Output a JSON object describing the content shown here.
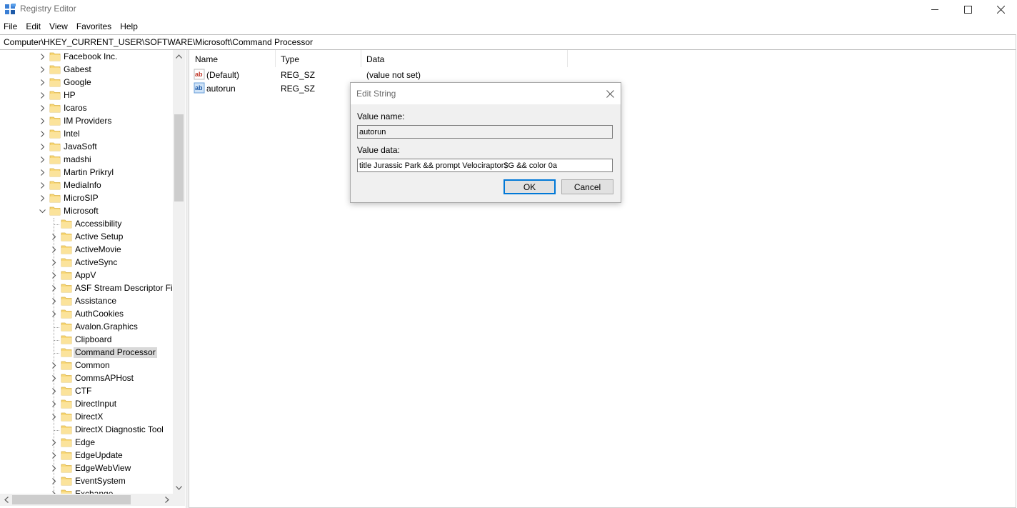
{
  "window": {
    "title": "Registry Editor"
  },
  "menu": [
    "File",
    "Edit",
    "View",
    "Favorites",
    "Help"
  ],
  "address": "Computer\\HKEY_CURRENT_USER\\SOFTWARE\\Microsoft\\Command Processor",
  "tree": {
    "items": [
      {
        "label": "Facebook Inc.",
        "level": 1,
        "expander": "collapsed"
      },
      {
        "label": "Gabest",
        "level": 1,
        "expander": "collapsed"
      },
      {
        "label": "Google",
        "level": 1,
        "expander": "collapsed"
      },
      {
        "label": "HP",
        "level": 1,
        "expander": "collapsed"
      },
      {
        "label": "Icaros",
        "level": 1,
        "expander": "collapsed"
      },
      {
        "label": "IM Providers",
        "level": 1,
        "expander": "collapsed"
      },
      {
        "label": "Intel",
        "level": 1,
        "expander": "collapsed"
      },
      {
        "label": "JavaSoft",
        "level": 1,
        "expander": "collapsed"
      },
      {
        "label": "madshi",
        "level": 1,
        "expander": "collapsed"
      },
      {
        "label": "Martin Prikryl",
        "level": 1,
        "expander": "collapsed"
      },
      {
        "label": "MediaInfo",
        "level": 1,
        "expander": "collapsed"
      },
      {
        "label": "MicroSIP",
        "level": 1,
        "expander": "collapsed"
      },
      {
        "label": "Microsoft",
        "level": 1,
        "expander": "expanded"
      },
      {
        "label": "Accessibility",
        "level": 2,
        "expander": "none"
      },
      {
        "label": "Active Setup",
        "level": 2,
        "expander": "collapsed"
      },
      {
        "label": "ActiveMovie",
        "level": 2,
        "expander": "collapsed"
      },
      {
        "label": "ActiveSync",
        "level": 2,
        "expander": "collapsed"
      },
      {
        "label": "AppV",
        "level": 2,
        "expander": "collapsed"
      },
      {
        "label": "ASF Stream Descriptor File",
        "level": 2,
        "expander": "collapsed"
      },
      {
        "label": "Assistance",
        "level": 2,
        "expander": "collapsed"
      },
      {
        "label": "AuthCookies",
        "level": 2,
        "expander": "collapsed"
      },
      {
        "label": "Avalon.Graphics",
        "level": 2,
        "expander": "none"
      },
      {
        "label": "Clipboard",
        "level": 2,
        "expander": "none"
      },
      {
        "label": "Command Processor",
        "level": 2,
        "expander": "none",
        "selected": true
      },
      {
        "label": "Common",
        "level": 2,
        "expander": "collapsed"
      },
      {
        "label": "CommsAPHost",
        "level": 2,
        "expander": "collapsed"
      },
      {
        "label": "CTF",
        "level": 2,
        "expander": "collapsed"
      },
      {
        "label": "DirectInput",
        "level": 2,
        "expander": "collapsed"
      },
      {
        "label": "DirectX",
        "level": 2,
        "expander": "collapsed"
      },
      {
        "label": "DirectX Diagnostic Tool",
        "level": 2,
        "expander": "none"
      },
      {
        "label": "Edge",
        "level": 2,
        "expander": "collapsed"
      },
      {
        "label": "EdgeUpdate",
        "level": 2,
        "expander": "collapsed"
      },
      {
        "label": "EdgeWebView",
        "level": 2,
        "expander": "collapsed"
      },
      {
        "label": "EventSystem",
        "level": 2,
        "expander": "collapsed"
      },
      {
        "label": "Exchange",
        "level": 2,
        "expander": "collapsed"
      }
    ]
  },
  "list": {
    "columns": [
      "Name",
      "Type",
      "Data"
    ],
    "rows": [
      {
        "name": "(Default)",
        "type": "REG_SZ",
        "data": "(value not set)",
        "icon": "string-value-icon"
      },
      {
        "name": "autorun",
        "type": "REG_SZ",
        "data": "",
        "icon": "string-value-icon"
      }
    ]
  },
  "dialog": {
    "title": "Edit String",
    "value_name_label": "Value name:",
    "value_name": "autorun",
    "value_data_label": "Value data:",
    "value_data": "title Jurassic Park && prompt Velociraptor$G && color 0a",
    "ok_label": "OK",
    "cancel_label": "Cancel"
  },
  "colors": {
    "folder": "#f8d775",
    "selection": "#d9d9d9",
    "accent": "#0078d7"
  }
}
